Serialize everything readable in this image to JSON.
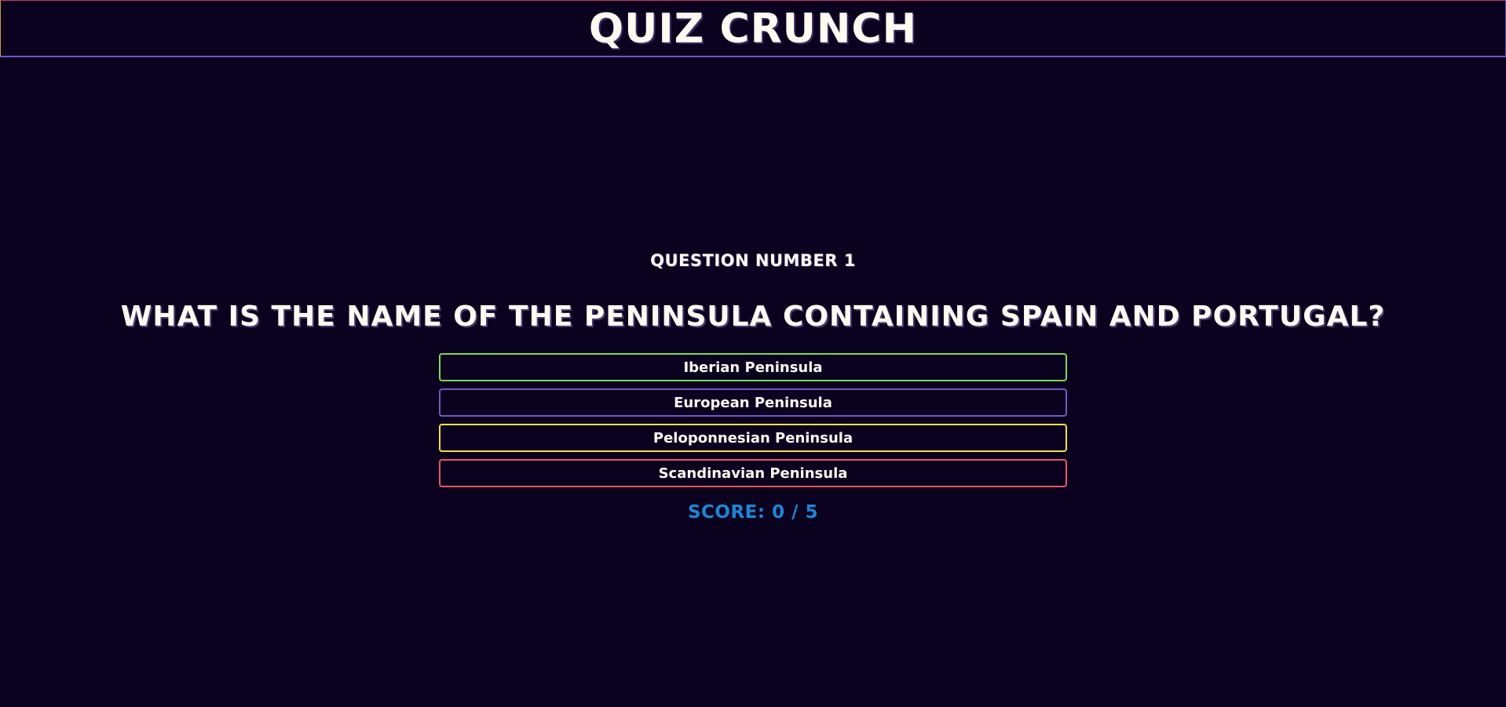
{
  "header": {
    "title": "QUIZ CRUNCH"
  },
  "quiz": {
    "question_number_label": "QUESTION NUMBER 1",
    "question_text": "WHAT IS THE NAME OF THE PENINSULA CONTAINING SPAIN AND PORTUGAL?",
    "answers": [
      {
        "label": "Iberian Peninsula",
        "border_color": "#7ed957"
      },
      {
        "label": "European Peninsula",
        "border_color": "#6e5cc0"
      },
      {
        "label": "Peloponnesian Peninsula",
        "border_color": "#f2e14c"
      },
      {
        "label": "Scandinavian Peninsula",
        "border_color": "#e65a5a"
      }
    ],
    "score_text": "SCORE: 0 / 5"
  },
  "colors": {
    "background": "#0b0220",
    "score": "#1c86d6",
    "header_border": "#6e5cc0"
  }
}
